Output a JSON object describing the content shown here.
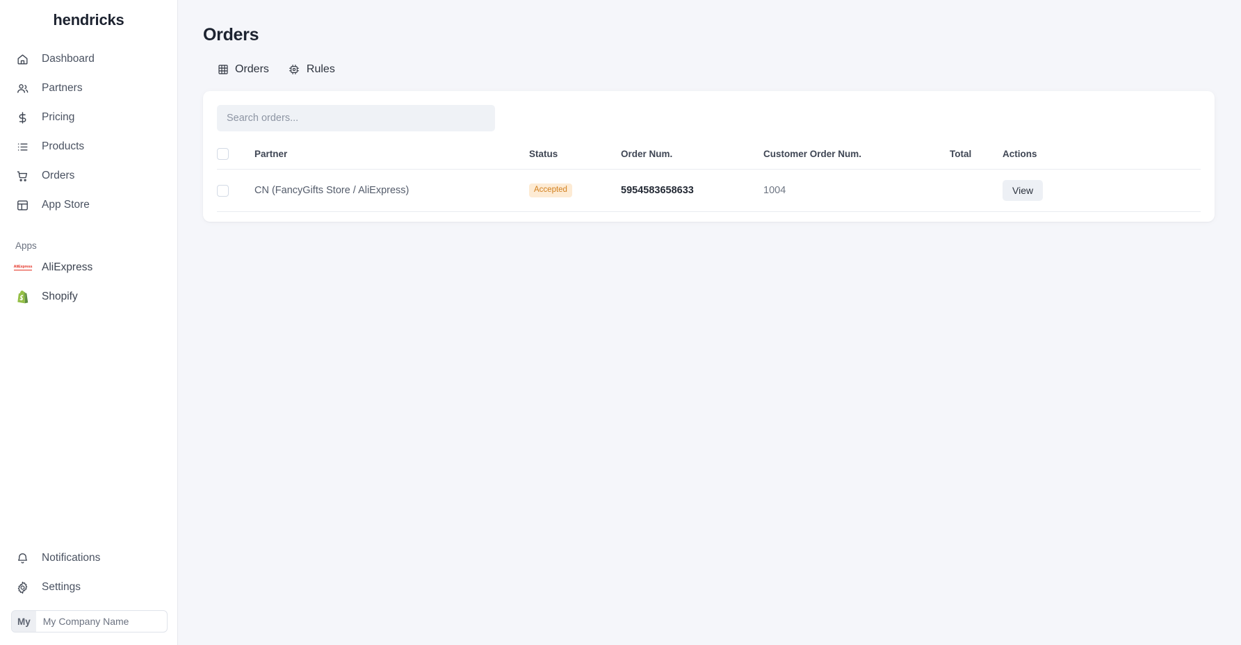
{
  "sidebar": {
    "brand": "hendricks",
    "items": [
      {
        "label": "Dashboard",
        "icon": "home-icon"
      },
      {
        "label": "Partners",
        "icon": "users-icon"
      },
      {
        "label": "Pricing",
        "icon": "dollar-icon"
      },
      {
        "label": "Products",
        "icon": "list-icon"
      },
      {
        "label": "Orders",
        "icon": "cart-icon"
      },
      {
        "label": "App Store",
        "icon": "layout-icon"
      }
    ],
    "apps_header": "Apps",
    "apps": [
      {
        "label": "AliExpress",
        "icon": "aliexpress-logo",
        "mark": "AliExpress"
      },
      {
        "label": "Shopify",
        "icon": "shopify-logo"
      }
    ],
    "bottom": [
      {
        "label": "Notifications",
        "icon": "bell-icon"
      },
      {
        "label": "Settings",
        "icon": "gear-icon"
      }
    ],
    "company": {
      "badge": "My",
      "name": "My Company Name"
    }
  },
  "main": {
    "title": "Orders",
    "tabs": [
      {
        "label": "Orders",
        "icon": "grid-icon",
        "active": true
      },
      {
        "label": "Rules",
        "icon": "chip-icon",
        "active": false
      }
    ],
    "search": {
      "placeholder": "Search orders...",
      "value": ""
    },
    "table": {
      "columns": [
        "",
        "Partner",
        "Status",
        "Order Num.",
        "Customer Order Num.",
        "Total",
        "Actions"
      ],
      "rows": [
        {
          "partner": "CN (FancyGifts Store / AliExpress)",
          "status": "Accepted",
          "order_num": "5954583658633",
          "customer_order_num": "1004",
          "total": "",
          "action_label": "View"
        }
      ]
    }
  },
  "colors": {
    "page_bg": "#f5f6fa",
    "sidebar_bg": "#ffffff",
    "card_bg": "#ffffff",
    "text_primary": "#1d2330",
    "text_secondary": "#545c6b",
    "badge_bg": "#fdebd4",
    "badge_text": "#d2801f",
    "button_bg": "#edf0f5",
    "search_bg": "#eff2f6"
  }
}
